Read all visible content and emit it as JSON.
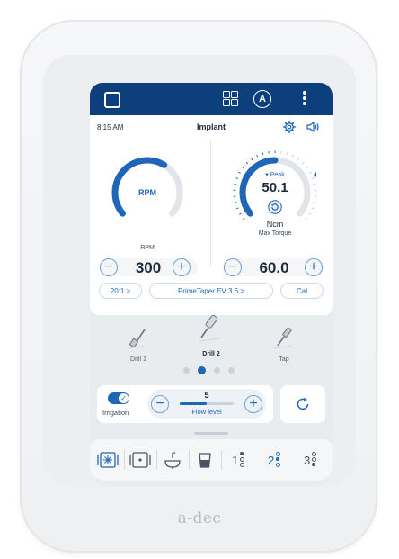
{
  "topbar": {
    "icons": [
      "square-icon",
      "grid-icon",
      "a-circle-icon",
      "more-vertical-icon"
    ],
    "account_letter": "A"
  },
  "header": {
    "time": "8:15 AM",
    "title": "Implant",
    "icons": [
      "gear-icon",
      "speaker-icon"
    ]
  },
  "rpm": {
    "gauge_label": "RPM",
    "label": "RPM",
    "value": "300",
    "gauge_fill_fraction": 0.62
  },
  "torque": {
    "peak_label": "Peak",
    "peak_value": "50.1",
    "unit": "Ncm",
    "label": "Max Torque",
    "value": "60.0",
    "gauge_fill_fraction": 0.5
  },
  "chips": {
    "ratio": "20:1 >",
    "implant": "PrimeTaper EV 3.6 >",
    "cal": "Cal"
  },
  "tools": [
    {
      "label": "Drill 1",
      "selected": false
    },
    {
      "label": "Drill 2",
      "selected": true
    },
    {
      "label": "Tap",
      "selected": false
    }
  ],
  "pager": {
    "count": 4,
    "active": 1
  },
  "irrigation": {
    "label": "Irrigation",
    "enabled": true
  },
  "flow": {
    "value": "5",
    "label": "Flow level",
    "fill_fraction": 0.5
  },
  "bottombar": {
    "icons": [
      "snowflake-box-icon",
      "dot-box-icon",
      "bowl-icon",
      "cup-icon",
      "position-1-icon",
      "position-2-icon",
      "position-3-icon"
    ],
    "numbers": [
      "1",
      "2",
      "3"
    ]
  },
  "brand": "a-dec",
  "colors": {
    "primary": "#1f65b8",
    "topbar": "#0d3f7d",
    "track": "#e1e4e8"
  }
}
